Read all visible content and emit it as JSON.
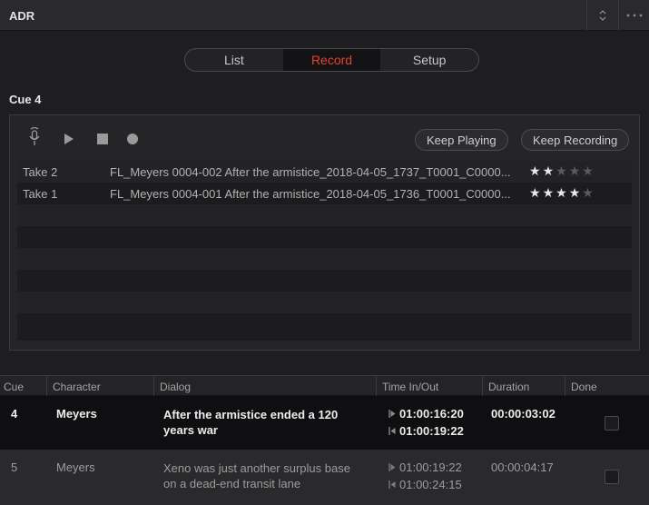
{
  "titlebar": {
    "title": "ADR"
  },
  "tabs": [
    {
      "label": "List",
      "active": false
    },
    {
      "label": "Record",
      "active": true
    },
    {
      "label": "Setup",
      "active": false
    }
  ],
  "cue_title": "Cue 4",
  "transport": {
    "keep_playing": "Keep Playing",
    "keep_recording": "Keep Recording"
  },
  "takes": [
    {
      "name": "Take 2",
      "file": "FL_Meyers 0004-002 After the armistice_2018-04-05_1737_T0001_C0000...",
      "rating": 2
    },
    {
      "name": "Take 1",
      "file": "FL_Meyers 0004-001 After the armistice_2018-04-05_1736_T0001_C0000...",
      "rating": 4
    }
  ],
  "columns": [
    "Cue",
    "Character",
    "Dialog",
    "Time In/Out",
    "Duration",
    "Done"
  ],
  "rows": [
    {
      "cue": "4",
      "character": "Meyers",
      "dialog_line1": "After the armistice ended a 120",
      "dialog_line2": "years war",
      "time_in": "01:00:16:20",
      "time_out": "01:00:19:22",
      "duration": "00:00:03:02",
      "selected": true
    },
    {
      "cue": "5",
      "character": "Meyers",
      "dialog_line1": "Xeno was just another surplus base",
      "dialog_line2": "on a dead-end transit lane",
      "time_in": "01:00:19:22",
      "time_out": "01:00:24:15",
      "duration": "00:00:04:17",
      "selected": false
    }
  ],
  "colors": {
    "accent_red": "#e5432f"
  }
}
